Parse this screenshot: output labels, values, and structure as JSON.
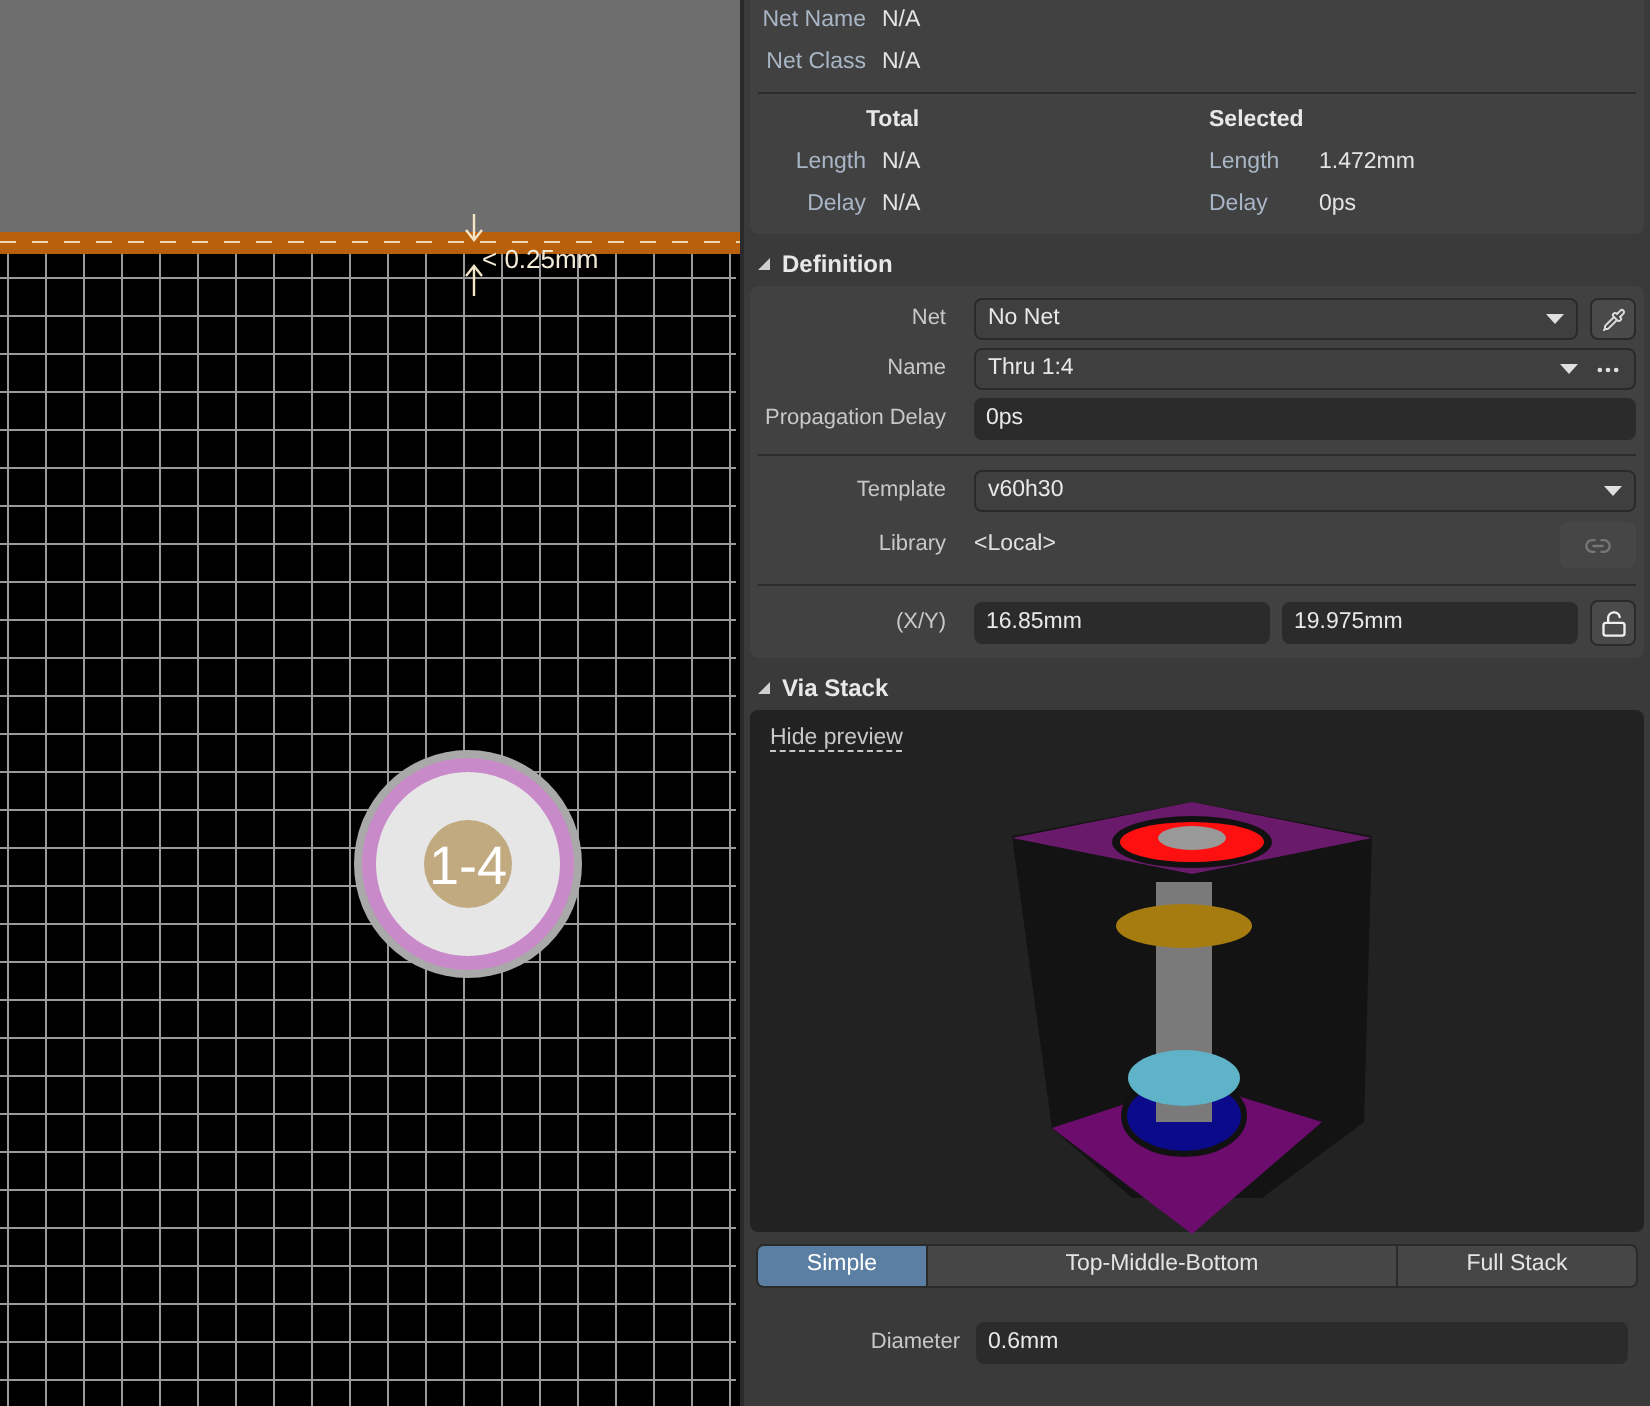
{
  "canvas": {
    "dimension_label": "< 0.25mm",
    "via_label": "1-4"
  },
  "net_info": {
    "rows": [
      {
        "label": "Net Name",
        "value": "N/A"
      },
      {
        "label": "Net Class",
        "value": "N/A"
      }
    ],
    "total": {
      "title": "Total",
      "rows": [
        {
          "label": "Length",
          "value": "N/A"
        },
        {
          "label": "Delay",
          "value": "N/A"
        }
      ]
    },
    "selected": {
      "title": "Selected",
      "rows": [
        {
          "label": "Length",
          "value": "1.472mm"
        },
        {
          "label": "Delay",
          "value": "0ps"
        }
      ]
    }
  },
  "definition": {
    "title": "Definition",
    "expanded": true,
    "net": {
      "label": "Net",
      "value": "No Net"
    },
    "name": {
      "label": "Name",
      "value": "Thru 1:4"
    },
    "propagation_delay": {
      "label": "Propagation Delay",
      "value": "0ps"
    },
    "template": {
      "label": "Template",
      "value": "v60h30"
    },
    "library": {
      "label": "Library",
      "value": "<Local>"
    },
    "xy": {
      "label": "(X/Y)",
      "x": "16.85mm",
      "y": "19.975mm"
    }
  },
  "via_stack": {
    "title": "Via Stack",
    "expanded": true,
    "preview_link": "Hide preview",
    "tabs": [
      {
        "label": "Simple",
        "selected": true
      },
      {
        "label": "Top-Middle-Bottom",
        "selected": false
      },
      {
        "label": "Full Stack",
        "selected": false
      }
    ],
    "diameter": {
      "label": "Diameter",
      "value": "0.6mm"
    }
  }
}
